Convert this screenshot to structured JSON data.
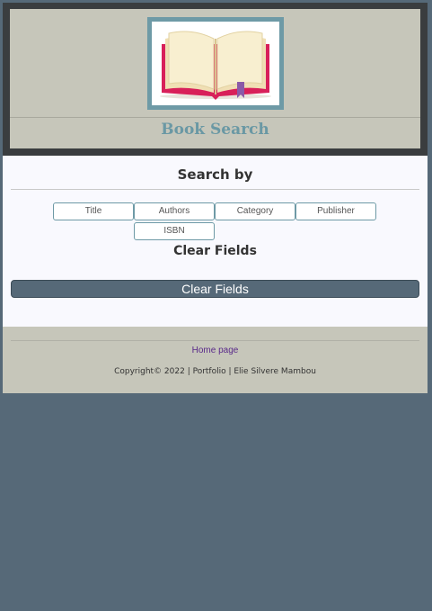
{
  "header": {
    "site_title": "Book Search",
    "logo_icon": "open-book-icon"
  },
  "search": {
    "heading": "Search by",
    "options": [
      "Title",
      "Authors",
      "Category",
      "Publisher",
      "ISBN"
    ]
  },
  "clear": {
    "heading": "Clear Fields",
    "button_label": "Clear Fields"
  },
  "footer": {
    "home_link": "Home page",
    "copyright": "Copyright© 2022 | Portfolio | Elie Silvere Mambou"
  },
  "colors": {
    "accent": "#6e9aa6",
    "dark_slate": "#566978",
    "beige": "#c6c6ba",
    "header_border": "#3a3d3f"
  }
}
